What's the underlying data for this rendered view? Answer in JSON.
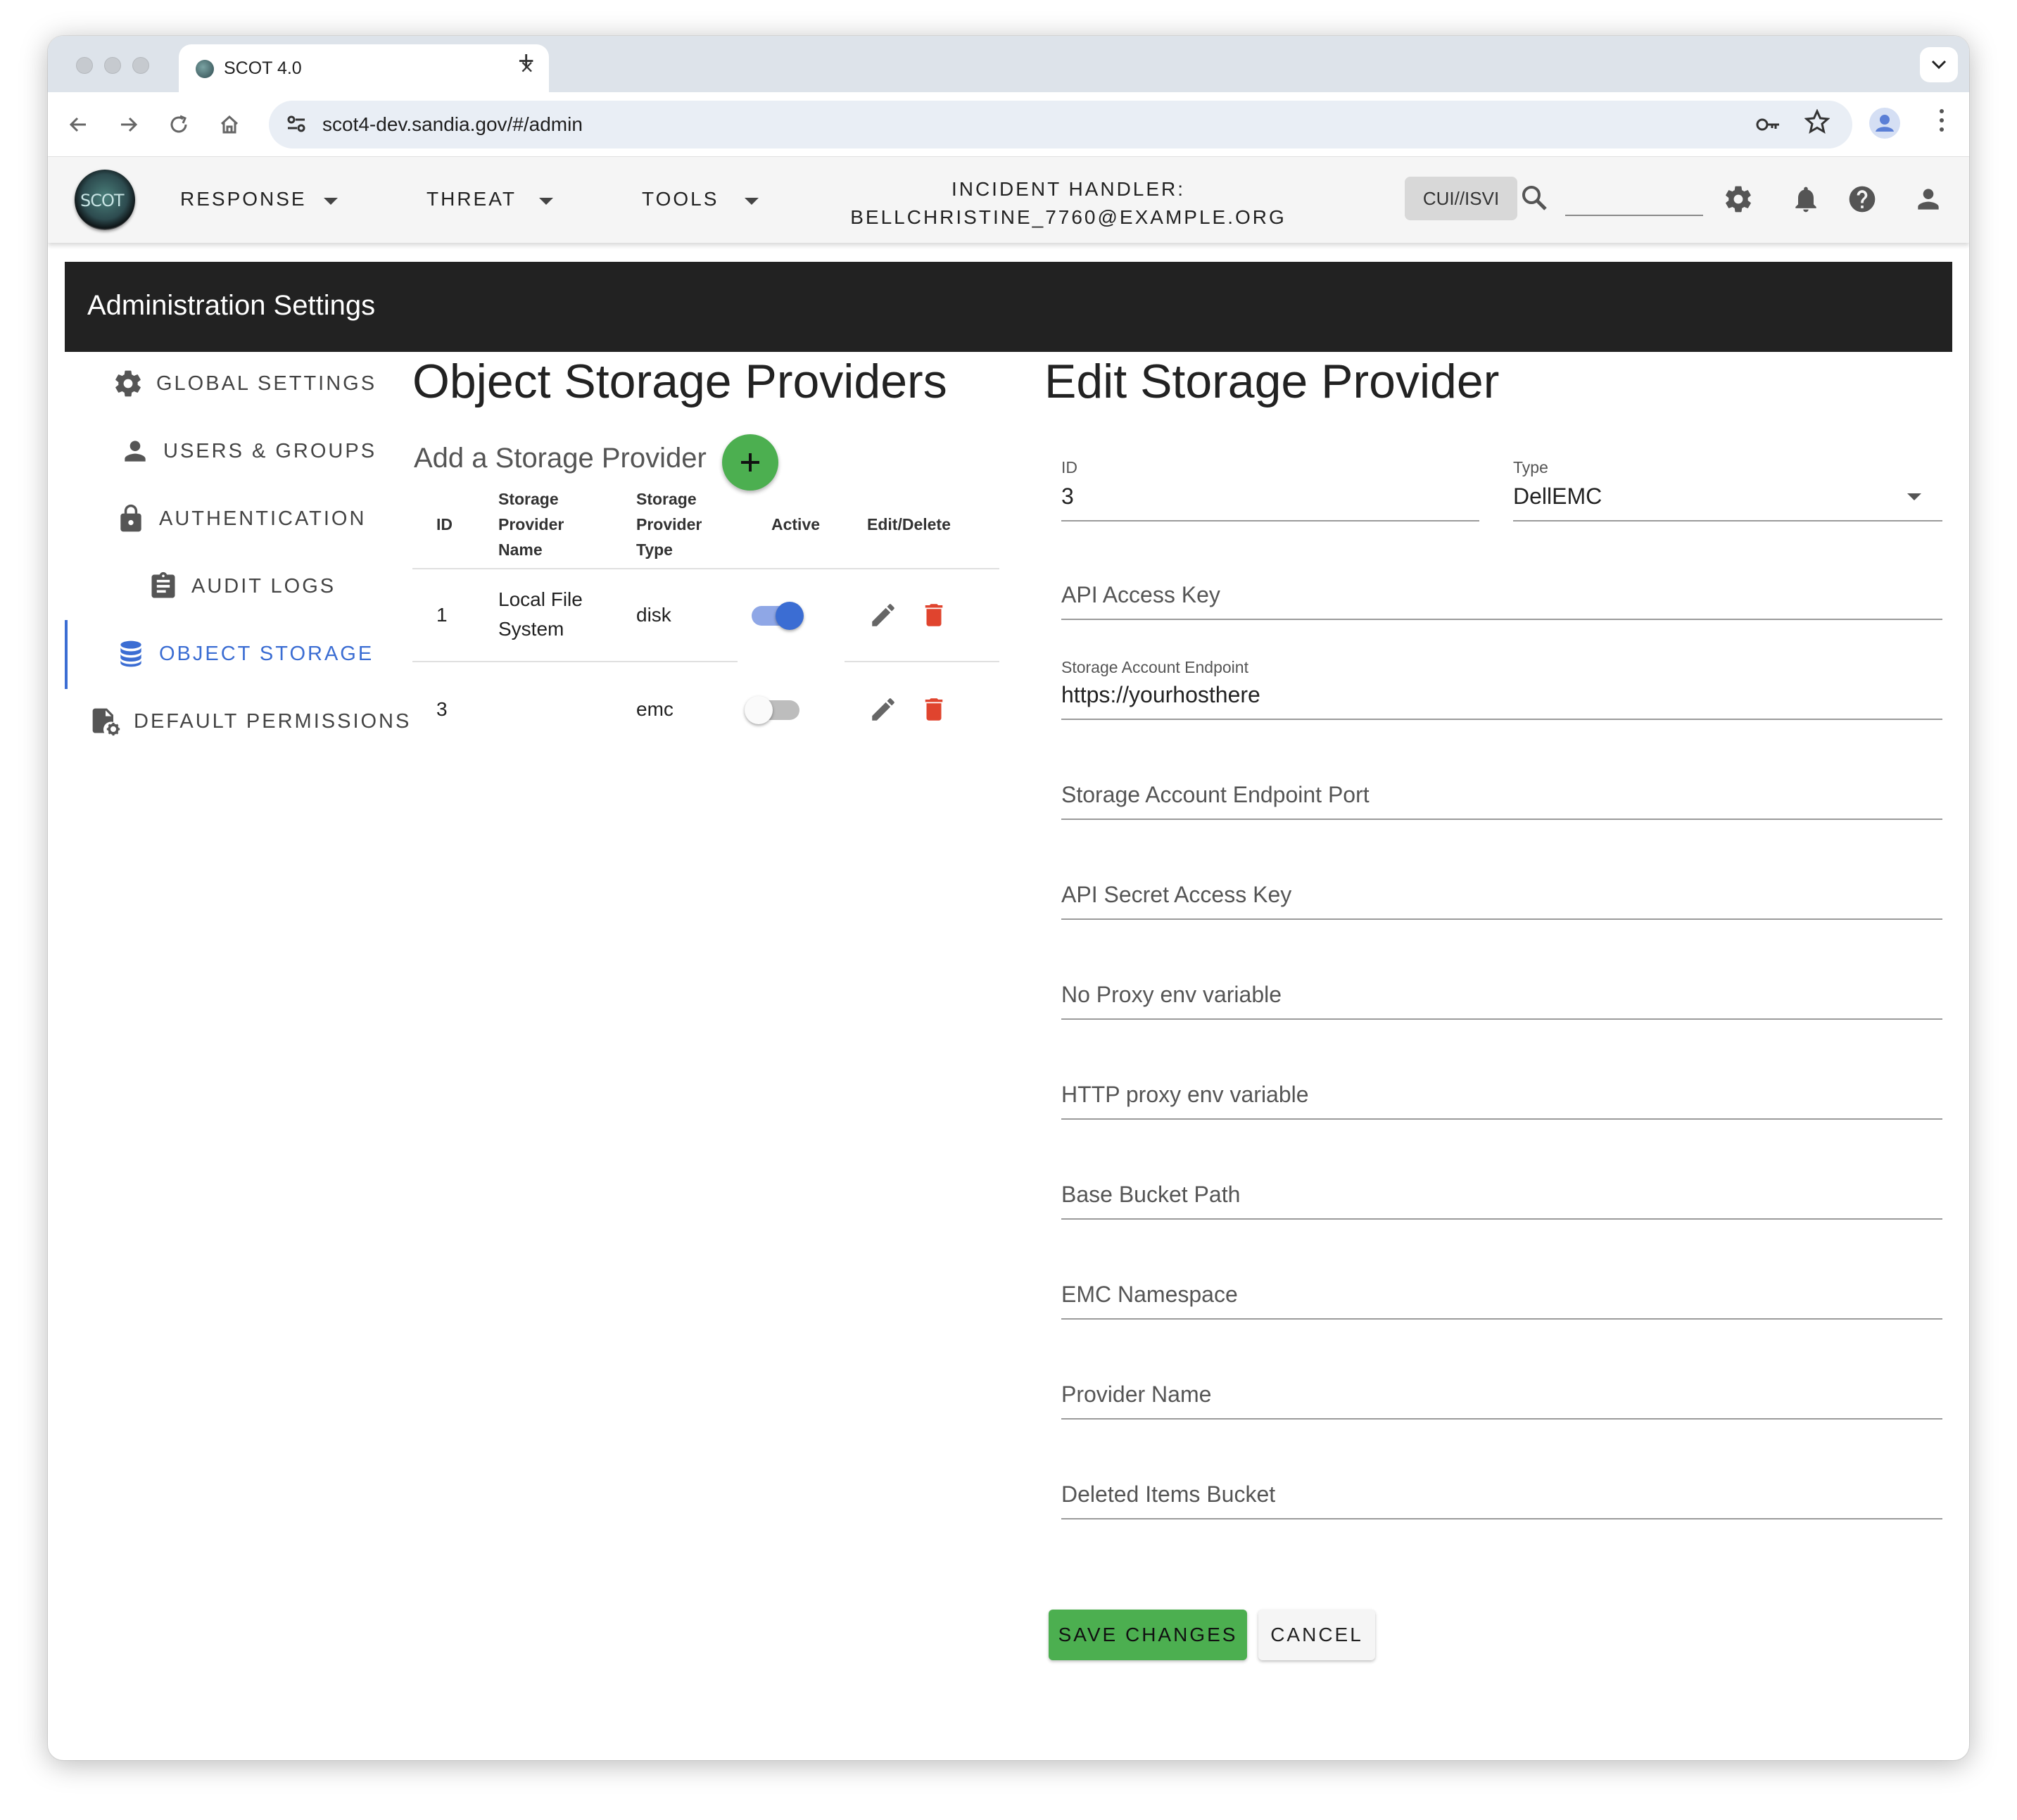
{
  "browser": {
    "tab_title": "SCOT 4.0",
    "tab_close": "×",
    "new_tab": "+",
    "url": "scot4-dev.sandia.gov/#/admin"
  },
  "app": {
    "logo_text": "SCOT",
    "menus": [
      "RESPONSE",
      "THREAT",
      "TOOLS"
    ],
    "handler_label": "INCIDENT HANDLER:",
    "handler_email": "BELLCHRISTINE_7760@EXAMPLE.ORG",
    "classification": "CUI//ISVI",
    "search_value": ""
  },
  "admin": {
    "title": "Administration Settings",
    "sidebar": [
      {
        "label": "GLOBAL SETTINGS",
        "icon": "gear-icon",
        "active": false
      },
      {
        "label": "USERS & GROUPS",
        "icon": "person-icon",
        "active": false
      },
      {
        "label": "AUTHENTICATION",
        "icon": "lock-icon",
        "active": false
      },
      {
        "label": "AUDIT LOGS",
        "icon": "clipboard-icon",
        "active": false
      },
      {
        "label": "OBJECT STORAGE",
        "icon": "database-icon",
        "active": true
      },
      {
        "label": "DEFAULT PERMISSIONS",
        "icon": "permissions-icon",
        "active": false
      }
    ]
  },
  "providers": {
    "title": "Object Storage Providers",
    "add_label": "Add a Storage Provider",
    "columns": {
      "id": "ID",
      "name": [
        "Storage",
        "Provider",
        "Name"
      ],
      "type": [
        "Storage",
        "Provider",
        "Type"
      ],
      "active": "Active",
      "actions": "Edit/Delete"
    },
    "rows": [
      {
        "id": "1",
        "name_line1": "Local File",
        "name_line2": "System",
        "type": "disk",
        "active": true
      },
      {
        "id": "3",
        "name_line1": "",
        "name_line2": "",
        "type": "emc",
        "active": false
      }
    ]
  },
  "edit": {
    "title": "Edit Storage Provider",
    "id_label": "ID",
    "id_value": "3",
    "type_label": "Type",
    "type_value": "DellEMC",
    "fields": [
      {
        "label": "API Access Key",
        "value": ""
      },
      {
        "label": "Storage Account Endpoint",
        "value": "https://yourhosthere"
      },
      {
        "label": "Storage Account Endpoint Port",
        "value": ""
      },
      {
        "label": "API Secret Access Key",
        "value": ""
      },
      {
        "label": "No Proxy env variable",
        "value": ""
      },
      {
        "label": "HTTP proxy env variable",
        "value": ""
      },
      {
        "label": "Base Bucket Path",
        "value": ""
      },
      {
        "label": "EMC Namespace",
        "value": ""
      },
      {
        "label": "Provider Name",
        "value": ""
      },
      {
        "label": "Deleted Items Bucket",
        "value": ""
      }
    ],
    "save_label": "SAVE CHANGES",
    "cancel_label": "CANCEL"
  },
  "colors": {
    "accent_blue": "#3b6dd3",
    "fab_green": "#4caf50",
    "save_green": "#4caf50",
    "delete_red": "#e0442e",
    "admin_bar": "#222222"
  }
}
